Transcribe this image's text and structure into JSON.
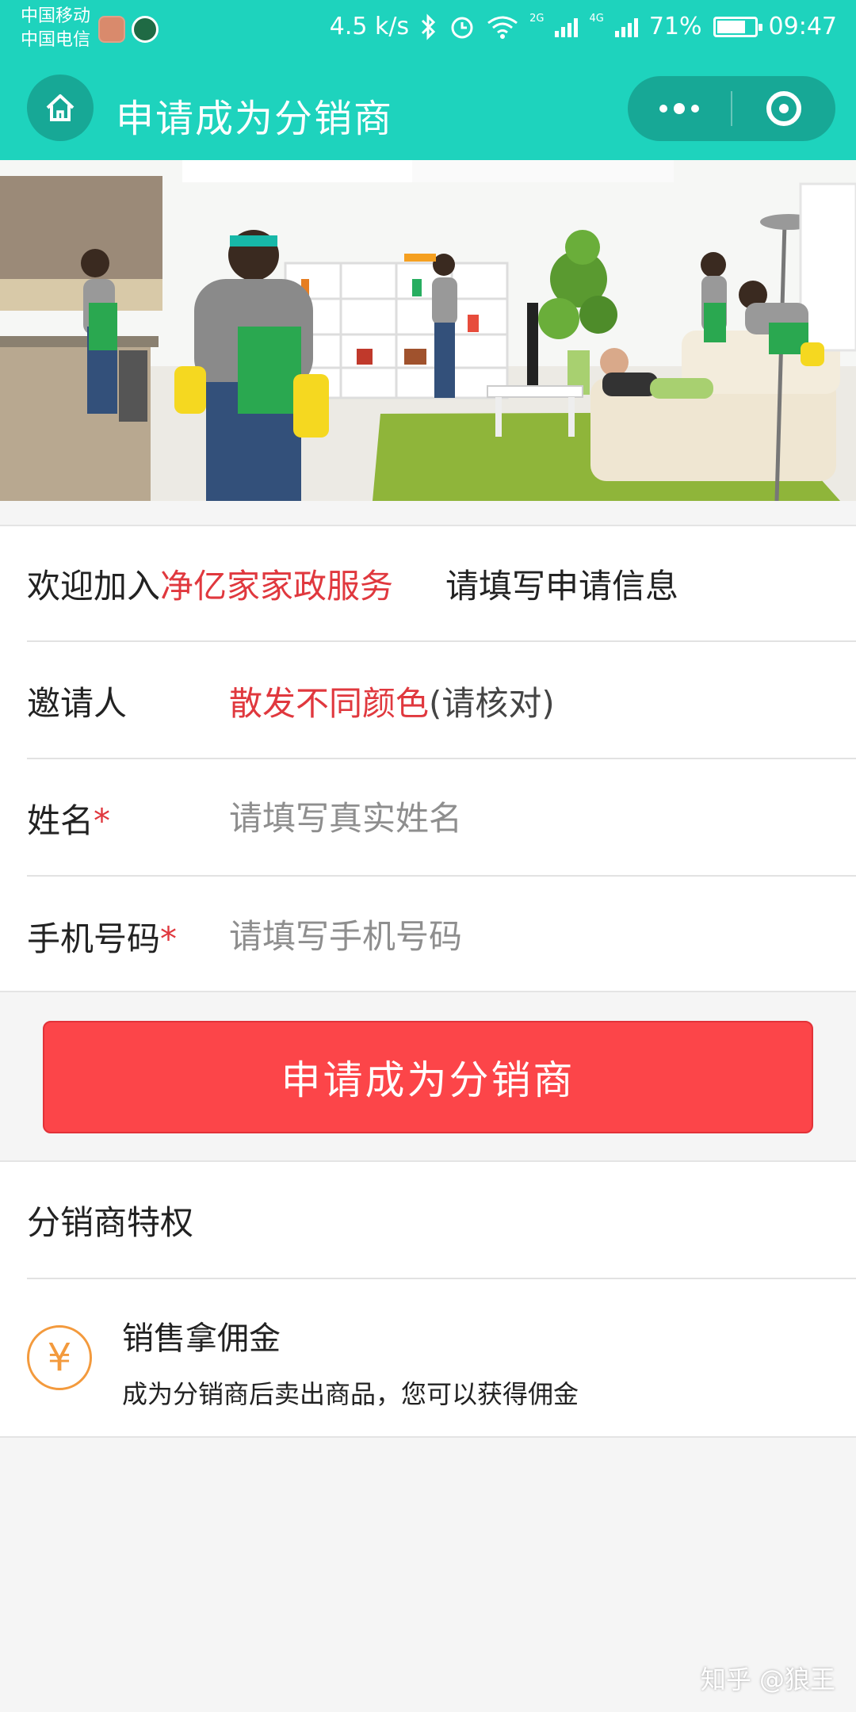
{
  "status_bar": {
    "carrier_1": "中国移动",
    "carrier_2": "中国电信",
    "net_speed": "4.5 k/s",
    "net_2g": "2G",
    "net_4g": "4G",
    "battery": "71%",
    "battery_level": 0.71,
    "time": "09:47"
  },
  "nav": {
    "title": "申请成为分销商"
  },
  "form": {
    "welcome_prefix": "欢迎加入",
    "company_name": "净亿家家政服务",
    "welcome_hint": "请填写申请信息",
    "inviter_label": "邀请人",
    "inviter_value": "散发不同颜色",
    "inviter_note": "(请核对)",
    "name_label": "姓名",
    "name_placeholder": "请填写真实姓名",
    "phone_label": "手机号码",
    "phone_placeholder": "请填写手机号码",
    "required_mark": "*"
  },
  "apply_button": "申请成为分销商",
  "privileges": {
    "title": "分销商特权",
    "items": [
      {
        "icon": "yen-icon",
        "symbol": "¥",
        "title": "销售拿佣金",
        "desc": "成为分销商后卖出商品，您可以获得佣金"
      }
    ]
  },
  "watermark": "知乎 @狼王",
  "colors": {
    "header": "#1ed3bd",
    "accent_red": "#fc4549",
    "highlight_red": "#e0383e",
    "coin_orange": "#f39a3d"
  }
}
